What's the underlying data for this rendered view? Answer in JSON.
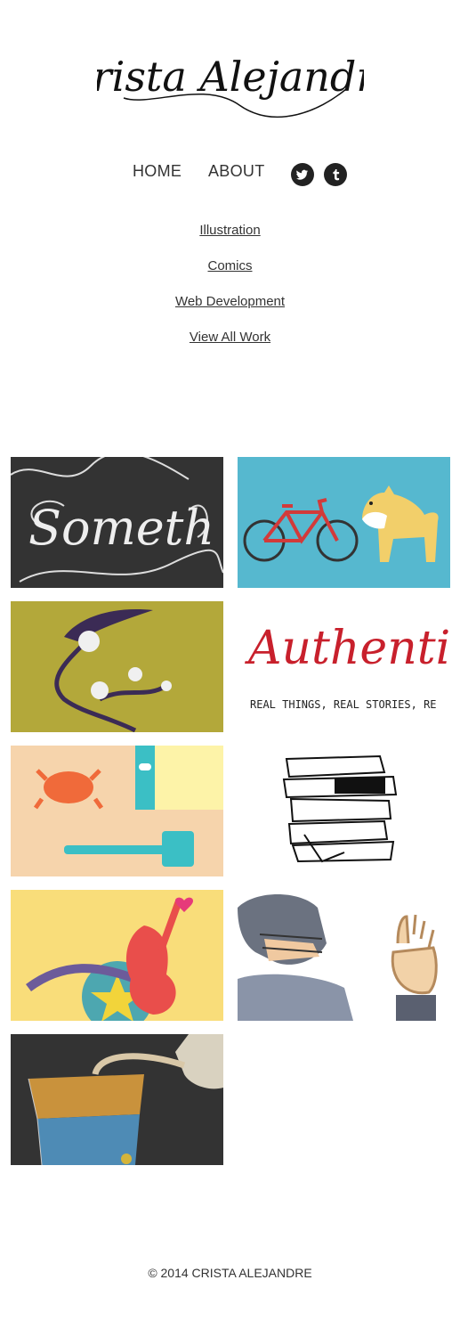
{
  "brand": {
    "logo_text": "Crista Alejandre"
  },
  "nav": {
    "home": "HOME",
    "about": "ABOUT",
    "twitter_icon": "twitter-icon",
    "tumblr_icon": "tumblr-icon"
  },
  "categories": [
    "Illustration",
    "Comics",
    "Web Development",
    "View All Work"
  ],
  "tiles": [
    {
      "icon": "lettering-something",
      "text": "Someth"
    },
    {
      "icon": "bicycle-and-dog"
    },
    {
      "icon": "thistle-and-feather"
    },
    {
      "icon": "authenticity-lettering",
      "text": "Authentici",
      "subtext": "REAL THINGS, REAL STORIES, RE"
    },
    {
      "icon": "crab-and-gavel"
    },
    {
      "icon": "stack-of-books"
    },
    {
      "icon": "guitar-and-shield"
    },
    {
      "icon": "football-player"
    },
    {
      "icon": "coffee-pour-over"
    }
  ],
  "footer": {
    "copyright": "© 2014 CRISTA ALEJANDRE"
  },
  "colors": {
    "text": "#333333",
    "dark_tile": "#333333",
    "teal_tile": "#56b8cf",
    "olive_tile": "#b3a83a",
    "peach_tile": "#f6d4ac",
    "yellow_tile": "#f9dd7a",
    "red": "#c8202c"
  }
}
